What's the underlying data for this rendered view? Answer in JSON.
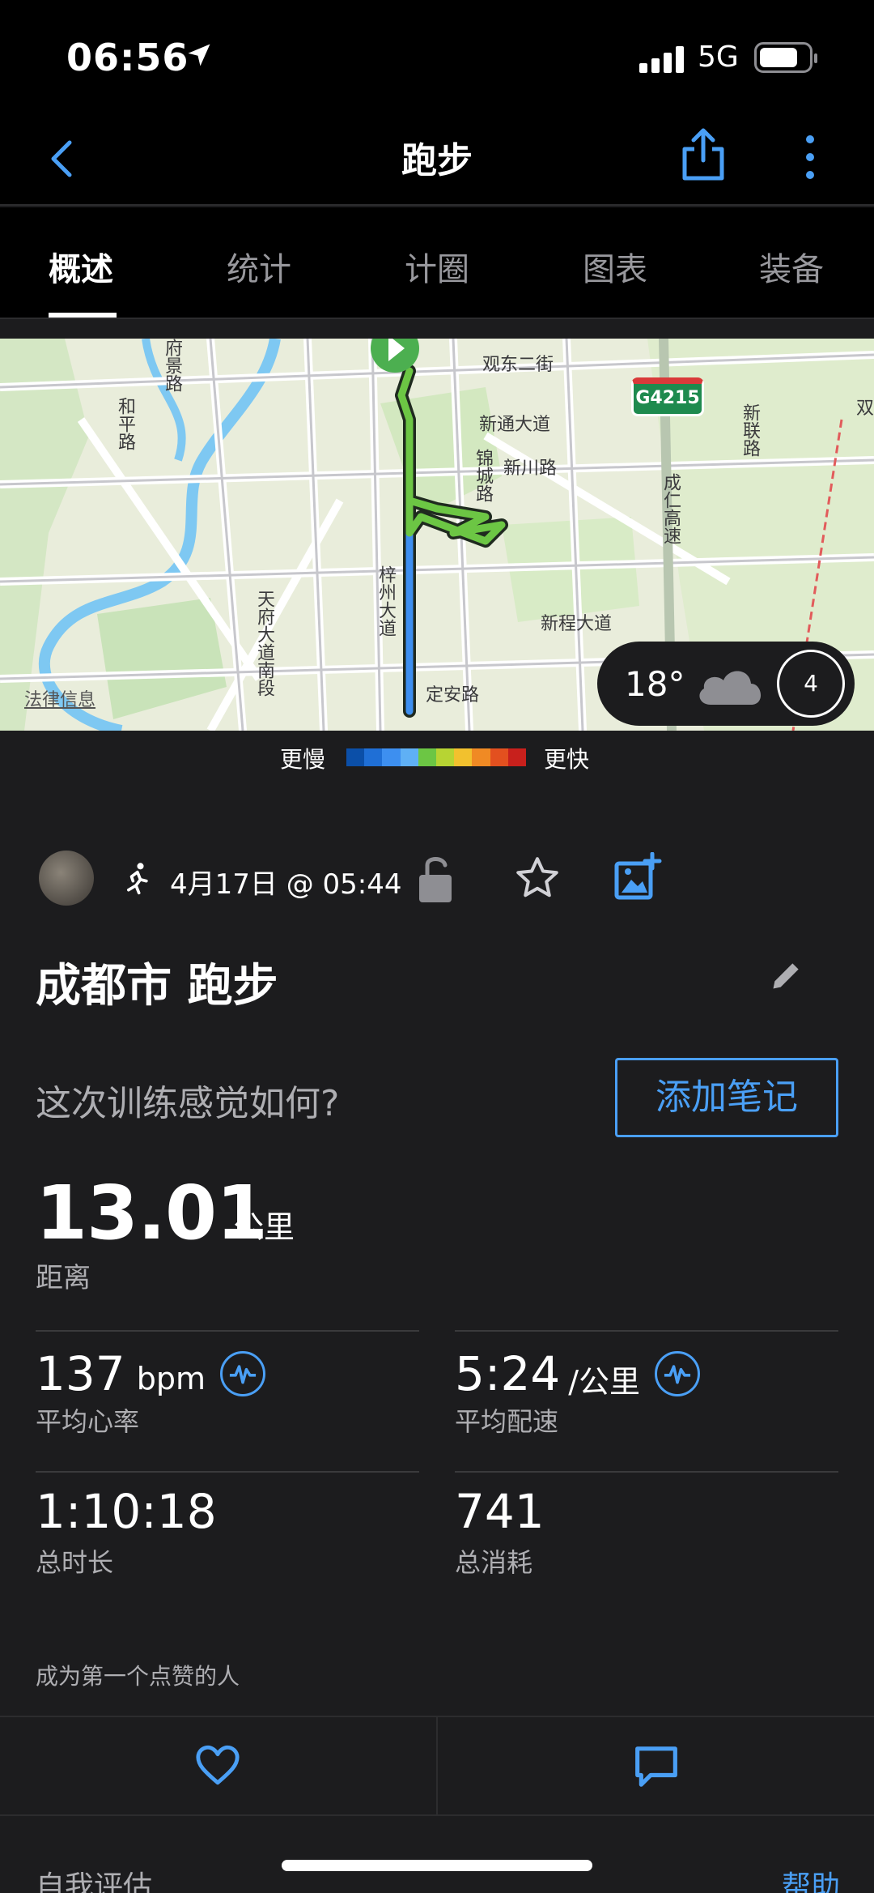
{
  "status_bar": {
    "time": "06:56",
    "network": "5G"
  },
  "navbar": {
    "title": "跑步"
  },
  "tabs": [
    {
      "label": "概述",
      "active": true
    },
    {
      "label": "统计",
      "active": false
    },
    {
      "label": "计圈",
      "active": false
    },
    {
      "label": "图表",
      "active": false
    },
    {
      "label": "装备",
      "active": false
    }
  ],
  "map": {
    "labels": {
      "l1": "观东二街",
      "l2": "新通大道",
      "l3": "新川路",
      "l4": "新程大道",
      "l5": "定安路",
      "l6": "天府大道南段",
      "l7": "梓州大道",
      "l8": "和平路",
      "l9": "新联路",
      "l10": "成仁高速",
      "l11": "锦城路",
      "l12": "双",
      "l13": "府景路"
    },
    "highway_badge": "G4215",
    "legal": "法律信息",
    "weather_temp": "18°",
    "wind_speed": "4"
  },
  "legend": {
    "slower": "更慢",
    "faster": "更快",
    "colors": [
      "#0b4fa8",
      "#1f6fd6",
      "#3d8ff0",
      "#5fb0f5",
      "#6cc644",
      "#b7d433",
      "#f2c12e",
      "#f08a24",
      "#e3501f",
      "#c8201c"
    ]
  },
  "activity": {
    "date": "4月17日 @ 05:44",
    "title": "成都市 跑步",
    "feel_prompt": "这次训练感觉如何?",
    "add_note": "添加笔记"
  },
  "distance": {
    "value": "13.01",
    "unit": "公里",
    "label": "距离"
  },
  "stats": {
    "hr": {
      "value": "137",
      "unit": "bpm",
      "label": "平均心率"
    },
    "pace": {
      "value": "5:24",
      "unit": "/公里",
      "label": "平均配速"
    },
    "duration": {
      "value": "1:10:18",
      "label": "总时长"
    },
    "calories": {
      "value": "741",
      "label": "总消耗"
    }
  },
  "social": {
    "likes_text": "成为第一个点赞的人"
  },
  "footer": {
    "self_eval": "自我评估",
    "help": "帮助"
  },
  "colors": {
    "accent": "#4a9ff5",
    "background": "#1c1c1e"
  }
}
